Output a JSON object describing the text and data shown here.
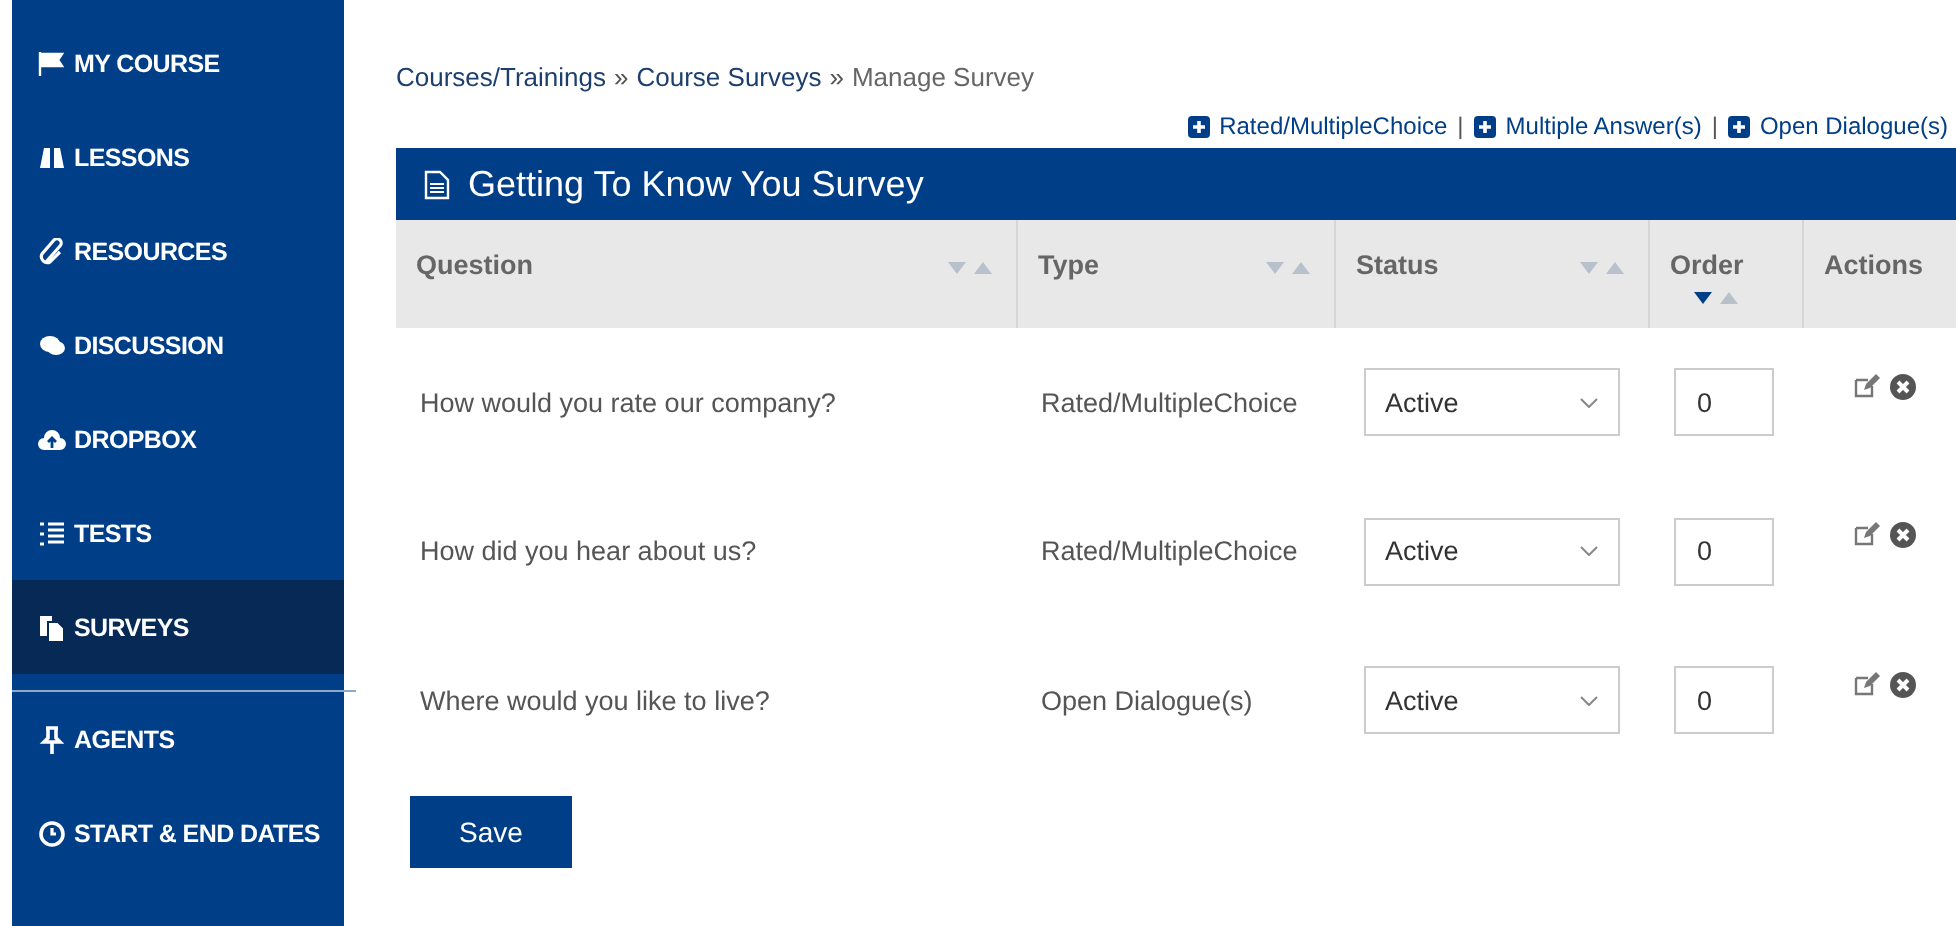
{
  "sidebar": {
    "items": [
      {
        "label": "MY COURSE",
        "selected": false
      },
      {
        "label": "LESSONS",
        "selected": false
      },
      {
        "label": "RESOURCES",
        "selected": false
      },
      {
        "label": "DISCUSSION",
        "selected": false
      },
      {
        "label": "DROPBOX",
        "selected": false
      },
      {
        "label": "TESTS",
        "selected": false
      },
      {
        "label": "SURVEYS",
        "selected": true
      },
      {
        "label": "AGENTS",
        "selected": false
      },
      {
        "label": "START & END DATES",
        "selected": false
      }
    ]
  },
  "breadcrumb": [
    {
      "label": "Courses/Trainings",
      "kind": "link"
    },
    {
      "label": "»",
      "kind": "sep"
    },
    {
      "label": "Course Surveys",
      "kind": "link"
    },
    {
      "label": "»",
      "kind": "sep"
    },
    {
      "label": "Manage Survey",
      "kind": "current"
    }
  ],
  "add_links": [
    {
      "label": "Rated/MultipleChoice",
      "kind": "link"
    },
    {
      "label": "|",
      "kind": "sep"
    },
    {
      "label": "Multiple Answer(s)",
      "kind": "link"
    },
    {
      "label": "|",
      "kind": "sep"
    },
    {
      "label": "Open Dialogue(s)",
      "kind": "link"
    }
  ],
  "panel": {
    "title": "Getting To Know You Survey"
  },
  "table": {
    "columns": [
      {
        "label": "Question",
        "sortable": true,
        "sorted_desc": false
      },
      {
        "label": "Type",
        "sortable": true,
        "sorted_desc": false
      },
      {
        "label": "Status",
        "sortable": true,
        "sorted_desc": false
      },
      {
        "label": "Order",
        "sortable": true,
        "sorted_desc": true
      },
      {
        "label": "Actions",
        "sortable": false
      }
    ],
    "rows": [
      {
        "question": "How would you rate our company?",
        "type": "Rated/MultipleChoice",
        "status": "Active",
        "order": "0"
      },
      {
        "question": "How did you hear about us?",
        "type": "Rated/MultipleChoice",
        "status": "Active",
        "order": "0"
      },
      {
        "question": "Where would you like to live?",
        "type": "Open Dialogue(s)",
        "status": "Active",
        "order": "0"
      }
    ]
  },
  "save_button": "Save"
}
